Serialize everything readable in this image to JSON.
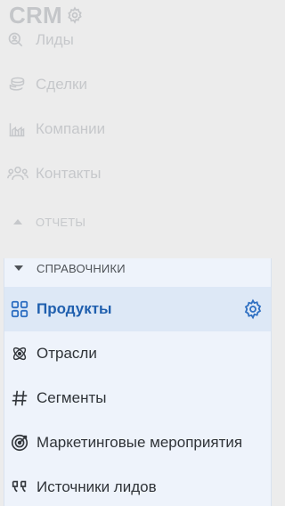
{
  "header": {
    "title": "CRM",
    "settings_icon": "gear-icon"
  },
  "nav_dim": [
    {
      "label": "Лиды",
      "icon": "search-person-icon"
    },
    {
      "label": "Сделки",
      "icon": "coins-icon"
    },
    {
      "label": "Компании",
      "icon": "building-icon"
    },
    {
      "label": "Контакты",
      "icon": "people-icon"
    }
  ],
  "sections": {
    "reports": {
      "label": "ОТЧЕТЫ",
      "state": "collapsed"
    },
    "references": {
      "label": "СПРАВОЧНИКИ",
      "state": "expanded"
    }
  },
  "references_items": [
    {
      "label": "Продукты",
      "icon": "grid-icon",
      "active": true
    },
    {
      "label": "Отрасли",
      "icon": "atom-icon"
    },
    {
      "label": "Сегменты",
      "icon": "hash-icon"
    },
    {
      "label": "Маркетинговые мероприятия",
      "icon": "target-icon"
    },
    {
      "label": "Источники лидов",
      "icon": "quote-icon"
    }
  ],
  "colors": {
    "accent": "#2e6fc2",
    "active_bg": "#dde8f6",
    "panel_bg": "#eef3fb",
    "dim_text": "#c6c8cb"
  }
}
